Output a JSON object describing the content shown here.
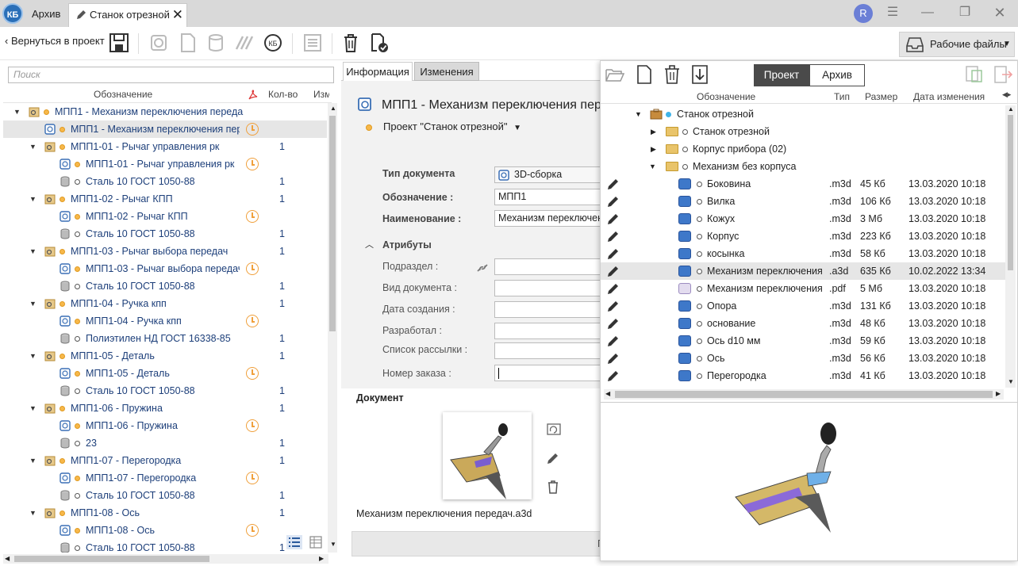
{
  "titlebar": {
    "logo": "КБ",
    "tab_archive": "Архив",
    "tab_active": "Станок отрезной",
    "avatar": "R"
  },
  "toolbar": {
    "back_label": "Вернуться в проект",
    "workfiles_label": "Рабочие файлы"
  },
  "left": {
    "search_placeholder": "Поиск",
    "columns": [
      "Обозначение",
      "Кол-во",
      "Изм"
    ],
    "rows": [
      {
        "text": "МПП1 - Механизм переключения переда",
        "qty": "",
        "level": 0,
        "kind": "assembly",
        "arrow": true,
        "clock": false,
        "dot": "orange"
      },
      {
        "text": "МПП1 - Механизм переключения пер",
        "qty": "",
        "level": 1,
        "kind": "model",
        "arrow": false,
        "clock": true,
        "dot": "orange",
        "selected": true
      },
      {
        "text": "МПП1-01 - Рычаг управления рк",
        "qty": "1",
        "level": 1,
        "kind": "assembly",
        "arrow": true,
        "clock": false,
        "dot": "orange"
      },
      {
        "text": "МПП1-01 - Рычаг управления рк",
        "qty": "",
        "level": 2,
        "kind": "model",
        "arrow": false,
        "clock": true,
        "dot": "orange"
      },
      {
        "text": "Сталь 10 ГОСТ 1050-88",
        "qty": "1",
        "level": 2,
        "kind": "material",
        "arrow": false,
        "clock": false,
        "dot": "white"
      },
      {
        "text": "МПП1-02 - Рычаг КПП",
        "qty": "1",
        "level": 1,
        "kind": "assembly",
        "arrow": true,
        "clock": false,
        "dot": "orange"
      },
      {
        "text": "МПП1-02 - Рычаг КПП",
        "qty": "",
        "level": 2,
        "kind": "model",
        "arrow": false,
        "clock": true,
        "dot": "orange"
      },
      {
        "text": "Сталь 10 ГОСТ 1050-88",
        "qty": "1",
        "level": 2,
        "kind": "material",
        "arrow": false,
        "clock": false,
        "dot": "white"
      },
      {
        "text": "МПП1-03 - Рычаг выбора передач",
        "qty": "1",
        "level": 1,
        "kind": "assembly",
        "arrow": true,
        "clock": false,
        "dot": "orange"
      },
      {
        "text": "МПП1-03 - Рычаг выбора передач",
        "qty": "",
        "level": 2,
        "kind": "model",
        "arrow": false,
        "clock": true,
        "dot": "orange"
      },
      {
        "text": "Сталь 10 ГОСТ 1050-88",
        "qty": "1",
        "level": 2,
        "kind": "material",
        "arrow": false,
        "clock": false,
        "dot": "white"
      },
      {
        "text": "МПП1-04 - Ручка кпп",
        "qty": "1",
        "level": 1,
        "kind": "assembly",
        "arrow": true,
        "clock": false,
        "dot": "orange"
      },
      {
        "text": "МПП1-04 - Ручка кпп",
        "qty": "",
        "level": 2,
        "kind": "model",
        "arrow": false,
        "clock": true,
        "dot": "orange"
      },
      {
        "text": "Полиэтилен НД ГОСТ 16338-85",
        "qty": "1",
        "level": 2,
        "kind": "material",
        "arrow": false,
        "clock": false,
        "dot": "white"
      },
      {
        "text": "МПП1-05 - Деталь",
        "qty": "1",
        "level": 1,
        "kind": "assembly",
        "arrow": true,
        "clock": false,
        "dot": "orange"
      },
      {
        "text": "МПП1-05 - Деталь",
        "qty": "",
        "level": 2,
        "kind": "model",
        "arrow": false,
        "clock": true,
        "dot": "orange"
      },
      {
        "text": "Сталь 10 ГОСТ 1050-88",
        "qty": "1",
        "level": 2,
        "kind": "material",
        "arrow": false,
        "clock": false,
        "dot": "white"
      },
      {
        "text": "МПП1-06 - Пружина",
        "qty": "1",
        "level": 1,
        "kind": "assembly",
        "arrow": true,
        "clock": false,
        "dot": "orange"
      },
      {
        "text": "МПП1-06 - Пружина",
        "qty": "",
        "level": 2,
        "kind": "model",
        "arrow": false,
        "clock": true,
        "dot": "orange"
      },
      {
        "text": "23",
        "qty": "1",
        "level": 2,
        "kind": "material",
        "arrow": false,
        "clock": false,
        "dot": "white"
      },
      {
        "text": "МПП1-07 - Перегородка",
        "qty": "1",
        "level": 1,
        "kind": "assembly",
        "arrow": true,
        "clock": false,
        "dot": "orange"
      },
      {
        "text": "МПП1-07 - Перегородка",
        "qty": "",
        "level": 2,
        "kind": "model",
        "arrow": false,
        "clock": true,
        "dot": "orange"
      },
      {
        "text": "Сталь 10 ГОСТ 1050-88",
        "qty": "1",
        "level": 2,
        "kind": "material",
        "arrow": false,
        "clock": false,
        "dot": "white"
      },
      {
        "text": "МПП1-08 - Ось",
        "qty": "1",
        "level": 1,
        "kind": "assembly",
        "arrow": true,
        "clock": false,
        "dot": "orange"
      },
      {
        "text": "МПП1-08 - Ось",
        "qty": "",
        "level": 2,
        "kind": "model",
        "arrow": false,
        "clock": true,
        "dot": "orange"
      },
      {
        "text": "Сталь 10 ГОСТ 1050-88",
        "qty": "1",
        "level": 2,
        "kind": "material",
        "arrow": false,
        "clock": false,
        "dot": "white"
      }
    ]
  },
  "middle": {
    "tab_info": "Информация",
    "tab_changes": "Изменения",
    "doc_title": "МПП1 - Механизм переключения пере",
    "project": "Проект \"Станок отрезной\"",
    "fields": {
      "doc_type_label": "Тип документа",
      "doc_type_value": "3D-сборка",
      "designation_label": "Обозначение :",
      "designation_value": "МПП1",
      "name_label": "Наименование :",
      "name_value": "Механизм переключен"
    },
    "attributes_title": "Атрибуты",
    "attributes": [
      "Подраздел :",
      "Вид документа :",
      "Дата создания :",
      "Разработал :",
      "Список рассылки :",
      "Номер заказа :"
    ],
    "document_title": "Документ",
    "file_name": "Механизм переключения передач.a3d",
    "bottom_button": "П"
  },
  "right": {
    "tab_project": "Проект",
    "tab_archive": "Архив",
    "columns": [
      "Обозначение",
      "Тип",
      "Размер",
      "Дата изменения"
    ],
    "root": "Станок отрезной",
    "folders": [
      "Станок отрезной",
      "Корпус прибора (02)",
      "Механизм без корпуса"
    ],
    "files": [
      {
        "name": "Боковина",
        "type": ".m3d",
        "size": "45 Кб",
        "date": "13.03.2020 10:18"
      },
      {
        "name": "Вилка",
        "type": ".m3d",
        "size": "106 Кб",
        "date": "13.03.2020 10:18"
      },
      {
        "name": "Кожух",
        "type": ".m3d",
        "size": "3 Мб",
        "date": "13.03.2020 10:18"
      },
      {
        "name": "Корпус",
        "type": ".m3d",
        "size": "223 Кб",
        "date": "13.03.2020 10:18"
      },
      {
        "name": "косынка",
        "type": ".m3d",
        "size": "58 Кб",
        "date": "13.03.2020 10:18"
      },
      {
        "name": "Механизм переключения",
        "type": ".a3d",
        "size": "635 Кб",
        "date": "10.02.2022 13:34",
        "selected": true
      },
      {
        "name": "Механизм переключения",
        "type": ".pdf",
        "size": "5 Мб",
        "date": "13.03.2020 10:18"
      },
      {
        "name": "Опора",
        "type": ".m3d",
        "size": "131 Кб",
        "date": "13.03.2020 10:18"
      },
      {
        "name": "основание",
        "type": ".m3d",
        "size": "48 Кб",
        "date": "13.03.2020 10:18"
      },
      {
        "name": "Ось d10 мм",
        "type": ".m3d",
        "size": "59 Кб",
        "date": "13.03.2020 10:18"
      },
      {
        "name": "Ось",
        "type": ".m3d",
        "size": "56 Кб",
        "date": "13.03.2020 10:18"
      },
      {
        "name": "Перегородка",
        "type": ".m3d",
        "size": "41 Кб",
        "date": "13.03.2020 10:18"
      }
    ]
  }
}
